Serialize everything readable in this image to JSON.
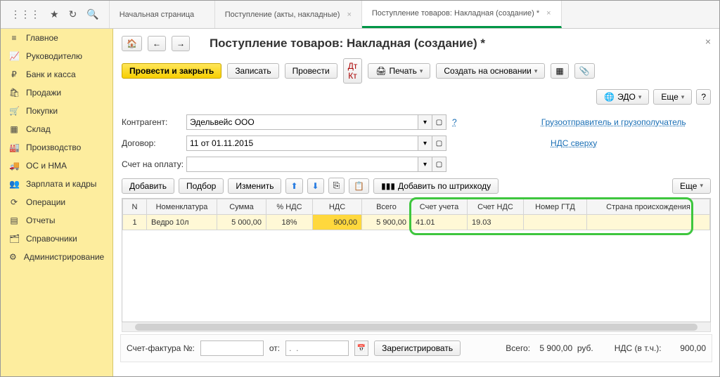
{
  "topbar": {
    "tabs": [
      {
        "label": "Начальная страница",
        "active": false
      },
      {
        "label": "Поступление (акты, накладные)",
        "active": false
      },
      {
        "label": "Поступление товаров: Накладная (создание) *",
        "active": true
      }
    ]
  },
  "sidebar": {
    "items": [
      {
        "icon": "≡",
        "label": "Главное"
      },
      {
        "icon": "📈",
        "label": "Руководителю"
      },
      {
        "icon": "₽",
        "label": "Банк и касса"
      },
      {
        "icon": "🛍",
        "label": "Продажи"
      },
      {
        "icon": "🛒",
        "label": "Покупки"
      },
      {
        "icon": "▦",
        "label": "Склад"
      },
      {
        "icon": "🏭",
        "label": "Производство"
      },
      {
        "icon": "🚚",
        "label": "ОС и НМА"
      },
      {
        "icon": "👥",
        "label": "Зарплата и кадры"
      },
      {
        "icon": "⟳",
        "label": "Операции"
      },
      {
        "icon": "▤",
        "label": "Отчеты"
      },
      {
        "icon": "🗂",
        "label": "Справочники"
      },
      {
        "icon": "⚙",
        "label": "Администрирование"
      }
    ]
  },
  "page": {
    "title": "Поступление товаров: Накладная (создание) *",
    "main_action": "Провести и закрыть",
    "actions": {
      "save": "Записать",
      "post": "Провести",
      "print": "Печать",
      "create_based": "Создать на основании",
      "edo": "ЭДО",
      "more": "Еще"
    },
    "form": {
      "contractor_label": "Контрагент:",
      "contractor_value": "Эдельвейс ООО",
      "contract_label": "Договор:",
      "contract_value": "11 от 01.11.2015",
      "invoice_label": "Счет на оплату:",
      "invoice_value": "",
      "shipper_link": "Грузоотправитель и грузополучатель",
      "vat_link": "НДС сверху"
    },
    "table_toolbar": {
      "add": "Добавить",
      "pick": "Подбор",
      "edit": "Изменить",
      "barcode": "Добавить по штрихкоду",
      "more": "Еще"
    },
    "columns": [
      "N",
      "Номенклатура",
      "Сумма",
      "% НДС",
      "НДС",
      "Всего",
      "Счет учета",
      "Счет НДС",
      "Номер ГТД",
      "Страна происхождения"
    ],
    "rows": [
      {
        "n": "1",
        "item": "Ведро 10л",
        "sum": "5 000,00",
        "vat_pct": "18%",
        "vat": "900,00",
        "total": "5 900,00",
        "acct": "41.01",
        "vat_acct": "19.03",
        "gtd": "",
        "country": ""
      }
    ],
    "footer": {
      "invoice_no_label": "Счет-фактура №:",
      "from_label": "от:",
      "date_placeholder": ".  .",
      "register": "Зарегистрировать",
      "total_label": "Всего:",
      "total_value": "5 900,00",
      "currency": "руб.",
      "vat_note_label": "НДС (в т.ч.):",
      "vat_note_value": "900,00"
    }
  }
}
